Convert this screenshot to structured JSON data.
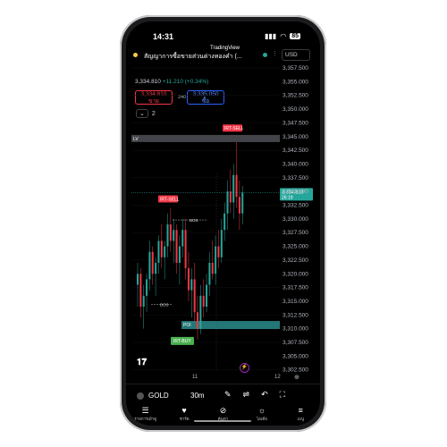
{
  "status": {
    "time": "14:31",
    "battery": "85"
  },
  "header": {
    "title": "สัญญาการซื้อขายส่วนต่างทองคำ (...",
    "logo": "TradingView",
    "currency": "USD"
  },
  "quote": {
    "price": "3,334.810",
    "change": "+11.210",
    "change_pct": "(+0.34%)"
  },
  "sell_box": {
    "price": "3,334.810",
    "label": "ขาย"
  },
  "buy_box": {
    "price": "3,335.050",
    "label": "ซื้อ"
  },
  "spread": "240",
  "indicators_count": "2",
  "price_axis": [
    "3,357.500",
    "3,355.000",
    "3,352.500",
    "3,350.000",
    "3,347.500",
    "3,345.000",
    "3,342.500",
    "3,340.000",
    "3,337.500",
    "3,335.000",
    "3,332.500",
    "3,330.000",
    "3,327.500",
    "3,325.000",
    "3,322.500",
    "3,320.000",
    "3,317.500",
    "3,315.000",
    "3,312.500",
    "3,310.000",
    "3,307.500",
    "3,305.000",
    "3,302.500"
  ],
  "current_price_tag": {
    "price": "3,334.810",
    "countdown": "26:19"
  },
  "chart_labels": {
    "irt_sell_top": "IRT-SELL",
    "irt_sell_mid": "IRT-SELL",
    "irt_buy": "IRT-BUY",
    "bos1": "BOS",
    "bos2": "BOS",
    "poi": "POI",
    "lv": "LV"
  },
  "time_axis": {
    "t1": "11",
    "t2": "12"
  },
  "toolbar": {
    "symbol": "GOLD",
    "timeframe": "30m"
  },
  "nav": [
    {
      "label": "รายการเฝ้าดู",
      "icon": "watchlist-icon"
    },
    {
      "label": "ชาร์ต",
      "icon": "chart-icon"
    },
    {
      "label": "ค้นหา",
      "icon": "explore-icon"
    },
    {
      "label": "ไอเดีย",
      "icon": "ideas-icon"
    },
    {
      "label": "เมนู",
      "icon": "menu-icon"
    }
  ],
  "colors": {
    "up": "#26a69a",
    "down": "#f23645",
    "poi": "#2a8c8c",
    "lv": "#787b86",
    "buy_label": "#4caf50"
  }
}
